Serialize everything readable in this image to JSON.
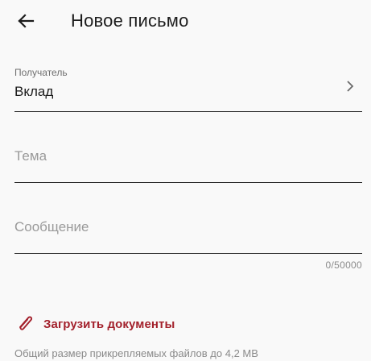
{
  "header": {
    "back_icon": "arrow-left-icon",
    "title": "Новое письмо"
  },
  "recipient": {
    "label": "Получатель",
    "value": "Вклад",
    "chevron_icon": "chevron-right-icon"
  },
  "subject": {
    "placeholder": "Тема"
  },
  "message": {
    "placeholder": "Сообщение",
    "counter": "0/50000"
  },
  "upload": {
    "icon": "paperclip-icon",
    "label": "Загрузить документы"
  },
  "hint": "Общий размер прикрепляемых файлов до 4,2 МВ",
  "colors": {
    "accent": "#a3212c",
    "background": "#f9f9f9",
    "text": "#1c1c1c",
    "muted": "#9a9a9a"
  }
}
